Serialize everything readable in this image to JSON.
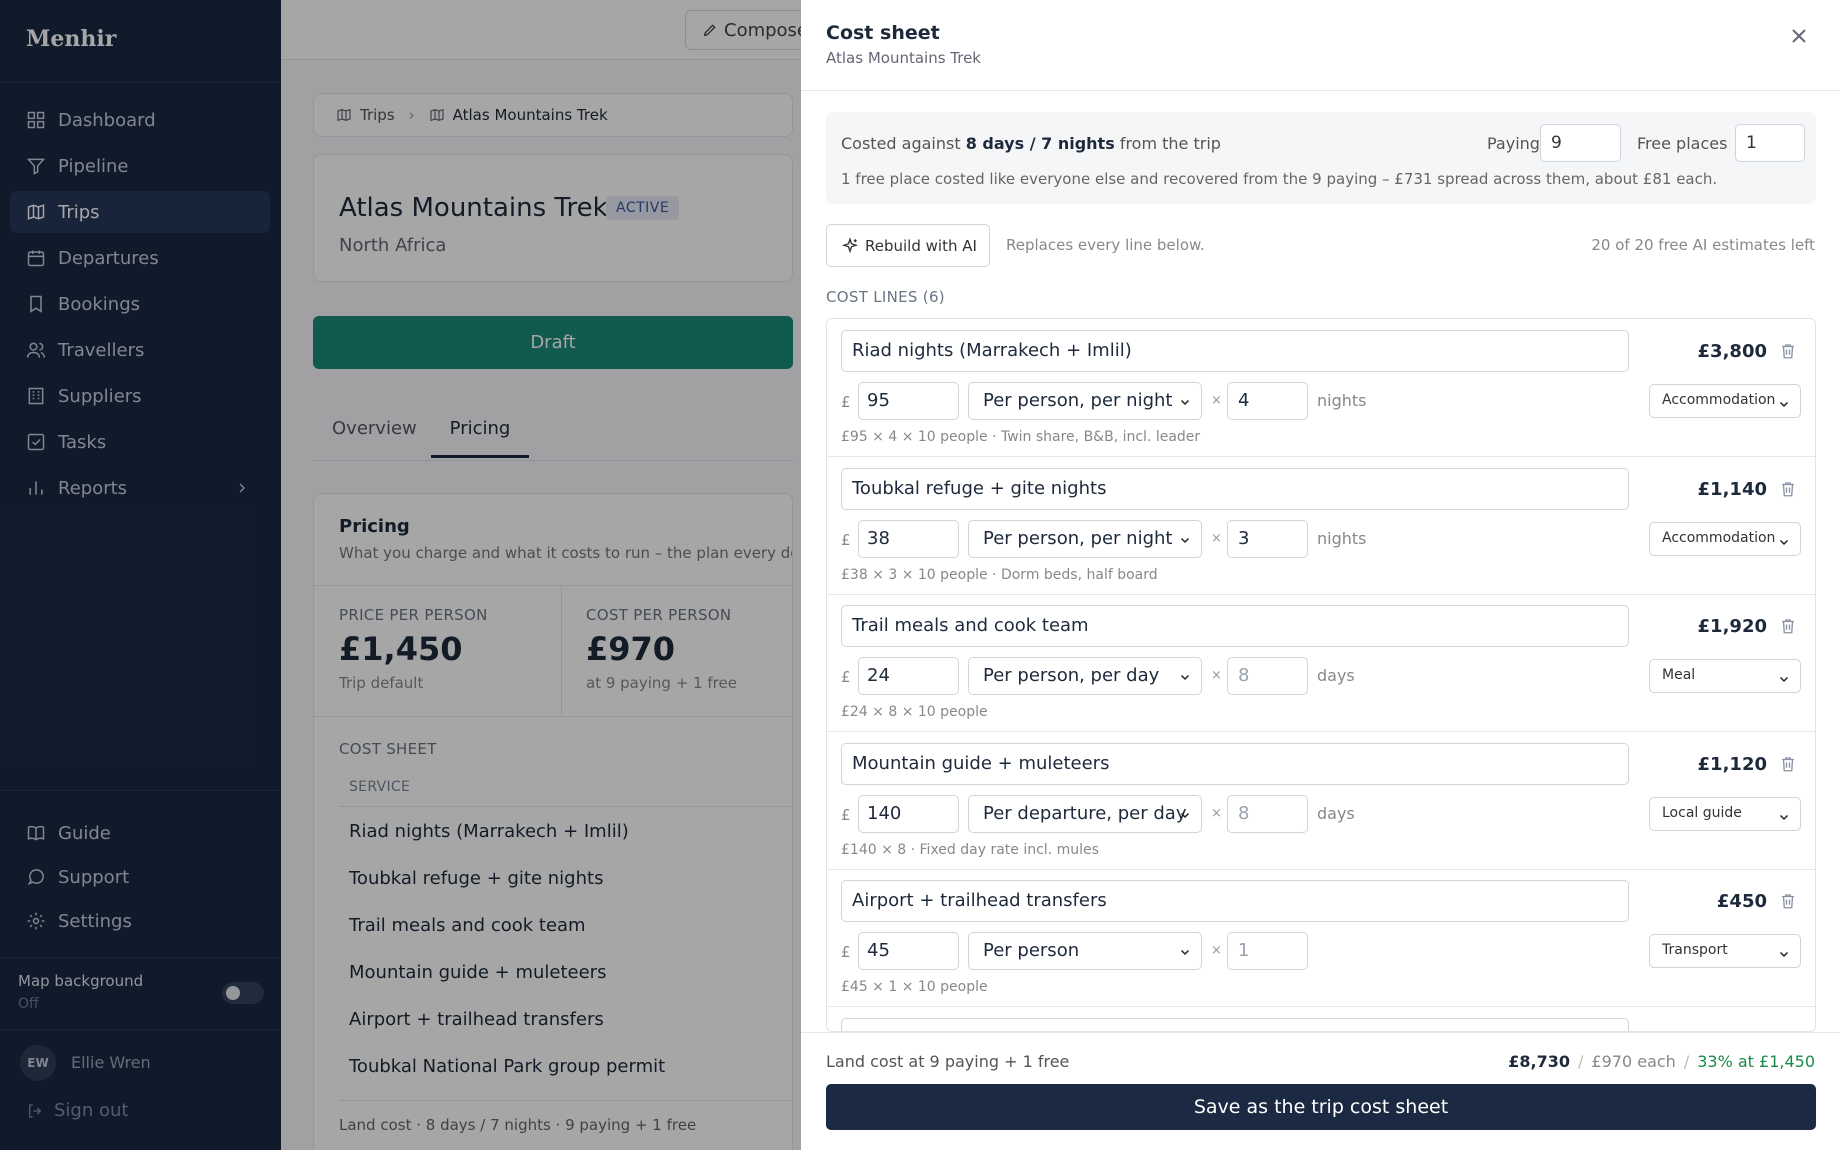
{
  "sidebar": {
    "brand": "Menhir",
    "nav": [
      {
        "label": "Dashboard",
        "icon": "dashboard-icon"
      },
      {
        "label": "Pipeline",
        "icon": "filter-icon"
      },
      {
        "label": "Trips",
        "icon": "map-icon",
        "active": true
      },
      {
        "label": "Departures",
        "icon": "calendar-icon"
      },
      {
        "label": "Bookings",
        "icon": "bookmark-icon"
      },
      {
        "label": "Travellers",
        "icon": "users-icon"
      },
      {
        "label": "Suppliers",
        "icon": "building-icon"
      },
      {
        "label": "Tasks",
        "icon": "checkbox-icon"
      },
      {
        "label": "Reports",
        "icon": "bar-chart-icon"
      }
    ],
    "bottom_nav": [
      {
        "label": "Guide",
        "icon": "book-icon"
      },
      {
        "label": "Support",
        "icon": "chat-icon"
      },
      {
        "label": "Settings",
        "icon": "gear-icon"
      }
    ],
    "map_background": {
      "label": "Map background",
      "state": "Off"
    },
    "user": {
      "initials": "EW",
      "name": "Ellie Wren"
    },
    "sign_out": "Sign out"
  },
  "topbar": {
    "compose": "Compose"
  },
  "breadcrumb": {
    "trips": "Trips",
    "current": "Atlas Mountains Trek"
  },
  "trip": {
    "title": "Atlas Mountains Trek",
    "status": "ACTIVE",
    "region": "North Africa",
    "draft_label": "Draft"
  },
  "tabs": {
    "overview": "Overview",
    "pricing": "Pricing"
  },
  "pricing": {
    "title": "Pricing",
    "subtitle": "What you charge and what it costs to run – the plan every depart",
    "price_label": "PRICE PER PERSON",
    "price_value": "£1,450",
    "price_note": "Trip default",
    "cost_label": "COST PER PERSON",
    "cost_value": "£970",
    "cost_note": "at 9 paying + 1 free",
    "cost_sheet_label": "COST SHEET",
    "service_header": "SERVICE",
    "services": [
      "Riad nights (Marrakech + Imlil)",
      "Toubkal refuge + gite nights",
      "Trail meals and cook team",
      "Mountain guide + muleteers",
      "Airport + trailhead transfers",
      "Toubkal National Park group permit"
    ],
    "land_note": "Land cost · 8 days / 7 nights · 9 paying + 1 free"
  },
  "panel": {
    "title": "Cost sheet",
    "subtitle": "Atlas Mountains Trek",
    "costed_prefix": "Costed against",
    "costed_bold": "8 days / 7 nights",
    "costed_suffix": "from the trip",
    "paying_label": "Paying",
    "paying_value": "9",
    "free_label": "Free places",
    "free_value": "1",
    "free_note": "1 free place costed like everyone else and recovered from the 9 paying – £731 spread across them, about £81 each.",
    "rebuild": "Rebuild with AI",
    "replaces": "Replaces every line below.",
    "ai_left": "20 of 20 free AI estimates left",
    "lines_label": "COST LINES (6)",
    "currency": "£",
    "times": "×",
    "lines": [
      {
        "name": "Riad nights (Marrakech + Imlil)",
        "total": "£3,800",
        "rate": "95",
        "unit": "Per person, per night",
        "qty": "4",
        "qty_unit": "nights",
        "category": "Accommodation",
        "formula": "£95 × 4 × 10 people · Twin share, B&B, incl. leader"
      },
      {
        "name": "Toubkal refuge + gite nights",
        "total": "£1,140",
        "rate": "38",
        "unit": "Per person, per night",
        "qty": "3",
        "qty_unit": "nights",
        "category": "Accommodation",
        "formula": "£38 × 3 × 10 people · Dorm beds, half board"
      },
      {
        "name": "Trail meals and cook team",
        "total": "£1,920",
        "rate": "24",
        "unit": "Per person, per day",
        "qty": "8",
        "qty_unit": "days",
        "category": "Meal",
        "formula": "£24 × 8 × 10 people"
      },
      {
        "name": "Mountain guide + muleteers",
        "total": "£1,120",
        "rate": "140",
        "unit": "Per departure, per day",
        "qty": "8",
        "qty_unit": "days",
        "category": "Local guide",
        "formula": "£140 × 8 · Fixed day rate incl. mules"
      },
      {
        "name": "Airport + trailhead transfers",
        "total": "£450",
        "rate": "45",
        "unit": "Per person",
        "qty": "1",
        "qty_unit": "",
        "category": "Transport",
        "formula": "£45 × 1 × 10 people"
      }
    ],
    "footer_label": "Land cost at 9 paying + 1 free",
    "footer_total": "£8,730",
    "footer_each": "£970 each",
    "footer_margin": "33% at £1,450",
    "save": "Save as the trip cost sheet"
  }
}
